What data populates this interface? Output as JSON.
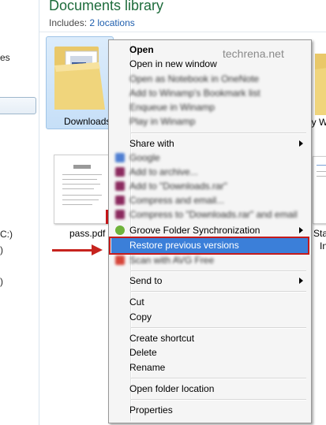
{
  "nav": {
    "items": [
      "es",
      "C:)",
      ")",
      ")"
    ]
  },
  "header": {
    "title": "Documents library",
    "includes_label": "Includes:",
    "includes_link": "2 locations"
  },
  "items": {
    "downloads_label": "Downloads",
    "pass_label": "pass.pdf",
    "right_folder_label": "ly W",
    "right_file_label_1": "Sta",
    "right_file_label_2": "In"
  },
  "watermark": "techrena.net",
  "menu": {
    "open": "Open",
    "open_new_window": "Open in new window",
    "blur_items_1": [
      "Open as Notebook in OneNote",
      "Add to Winamp's Bookmark list",
      "Enqueue in Winamp",
      "Play in Winamp"
    ],
    "share_with": "Share with",
    "blur_items_2": [
      "Google",
      "Add to archive...",
      "Add to \"Downloads.rar\"",
      "Compress and email...",
      "Compress to \"Downloads.rar\" and email"
    ],
    "groove": "Groove Folder Synchronization",
    "restore": "Restore previous versions",
    "blur_items_3": [
      "Scan with AVG Free"
    ],
    "send_to": "Send to",
    "cut": "Cut",
    "copy": "Copy",
    "create_shortcut": "Create shortcut",
    "delete": "Delete",
    "rename": "Rename",
    "open_folder_location": "Open folder location",
    "properties": "Properties"
  },
  "colors": {
    "title_green": "#1e6c3c",
    "link_blue": "#1f5fae",
    "highlight": "#3b7fd9",
    "annotation_red": "#c51b1b"
  }
}
